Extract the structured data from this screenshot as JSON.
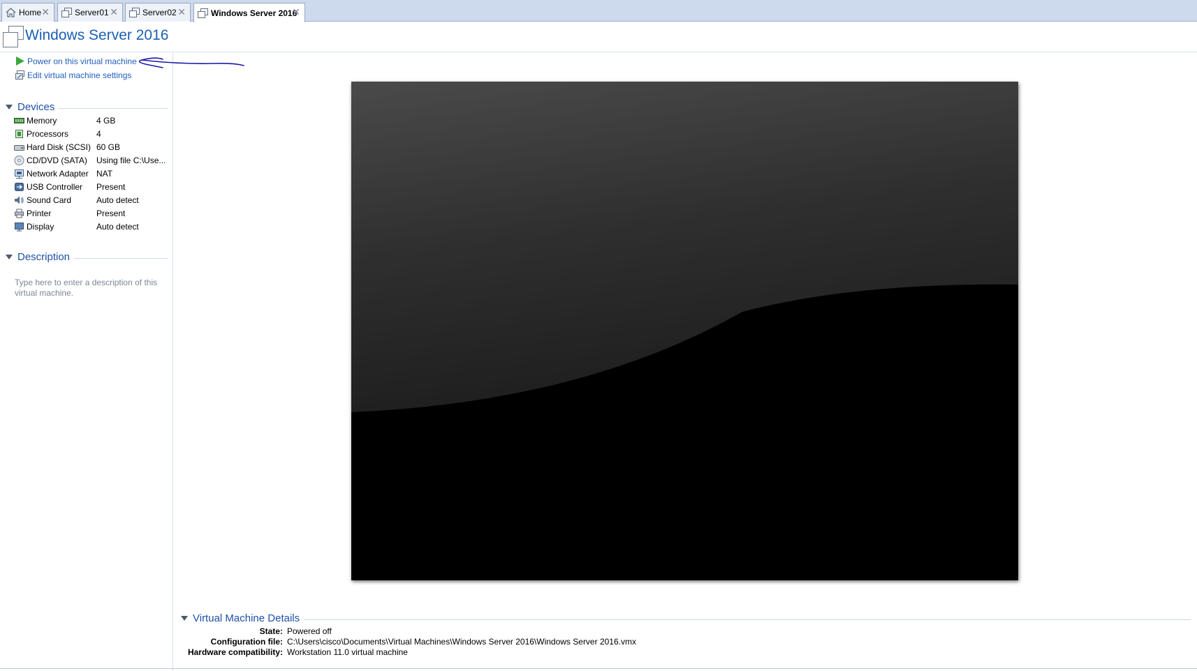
{
  "tabs": [
    {
      "label": "Home",
      "icon": "home-icon",
      "active": false
    },
    {
      "label": "Server01",
      "icon": "vm-icon",
      "active": false
    },
    {
      "label": "Server02",
      "icon": "vm-icon",
      "active": false
    },
    {
      "label": "Windows Server 2016",
      "icon": "vm-icon",
      "active": true
    }
  ],
  "vm": {
    "title": "Windows Server 2016"
  },
  "actions": {
    "power_on": "Power on this virtual machine",
    "edit_settings": "Edit virtual machine settings"
  },
  "devices": {
    "heading": "Devices",
    "items": [
      {
        "name": "Memory",
        "value": "4 GB",
        "icon": "memory-icon"
      },
      {
        "name": "Processors",
        "value": "4",
        "icon": "processor-icon"
      },
      {
        "name": "Hard Disk (SCSI)",
        "value": "60 GB",
        "icon": "hard-disk-icon"
      },
      {
        "name": "CD/DVD (SATA)",
        "value": "Using file C:\\Use...",
        "icon": "cd-dvd-icon"
      },
      {
        "name": "Network Adapter",
        "value": "NAT",
        "icon": "network-adapter-icon"
      },
      {
        "name": "USB Controller",
        "value": "Present",
        "icon": "usb-icon"
      },
      {
        "name": "Sound Card",
        "value": "Auto detect",
        "icon": "sound-icon"
      },
      {
        "name": "Printer",
        "value": "Present",
        "icon": "printer-icon"
      },
      {
        "name": "Display",
        "value": "Auto detect",
        "icon": "display-icon"
      }
    ]
  },
  "description": {
    "heading": "Description",
    "placeholder": "Type here to enter a description of this virtual machine."
  },
  "details": {
    "heading": "Virtual Machine Details",
    "rows": [
      {
        "key": "State:",
        "value": "Powered off"
      },
      {
        "key": "Configuration file:",
        "value": "C:\\Users\\cisco\\Documents\\Virtual Machines\\Windows Server 2016\\Windows Server 2016.vmx"
      },
      {
        "key": "Hardware compatibility:",
        "value": "Workstation 11.0 virtual machine"
      }
    ]
  },
  "colors": {
    "accent": "#1f5fbf",
    "title": "#1a5fb4",
    "tabbar": "#cdd9ec",
    "power_icon": "#3aa83a",
    "annotation": "#1a1aa8"
  }
}
